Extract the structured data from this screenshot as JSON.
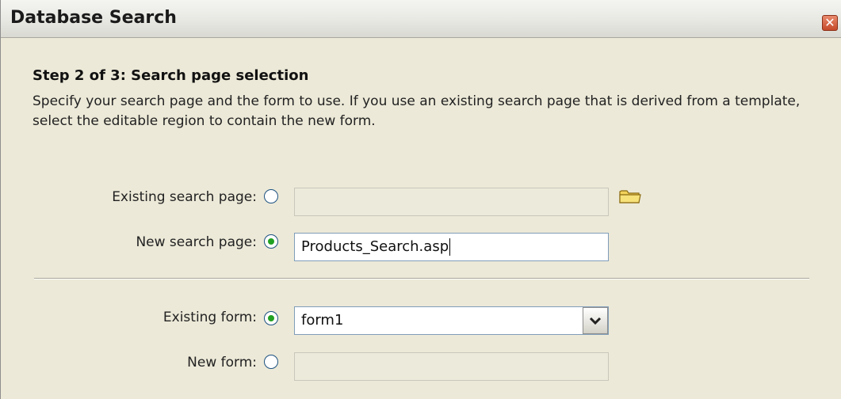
{
  "window": {
    "title": "Database Search",
    "close_icon": "close-icon"
  },
  "step": {
    "title": "Step 2 of 3: Search page selection",
    "description": "Specify your search page and the form to use. If you use an existing search page that is derived from a template, select the editable region to contain the new form."
  },
  "search_page": {
    "existing_label": "Existing search page:",
    "existing_selected": false,
    "existing_value": "",
    "browse_icon": "folder-icon",
    "new_label": "New search page:",
    "new_selected": true,
    "new_value": "Products_Search.asp"
  },
  "form": {
    "existing_label": "Existing form:",
    "existing_selected": true,
    "existing_value": "form1",
    "dropdown_icon": "chevron-down-icon",
    "new_label": "New form:",
    "new_selected": false,
    "new_value": ""
  },
  "colors": {
    "dialog_bg": "#ece9d8",
    "radio_dot": "#21a121",
    "close_button": "#c54a2a"
  }
}
